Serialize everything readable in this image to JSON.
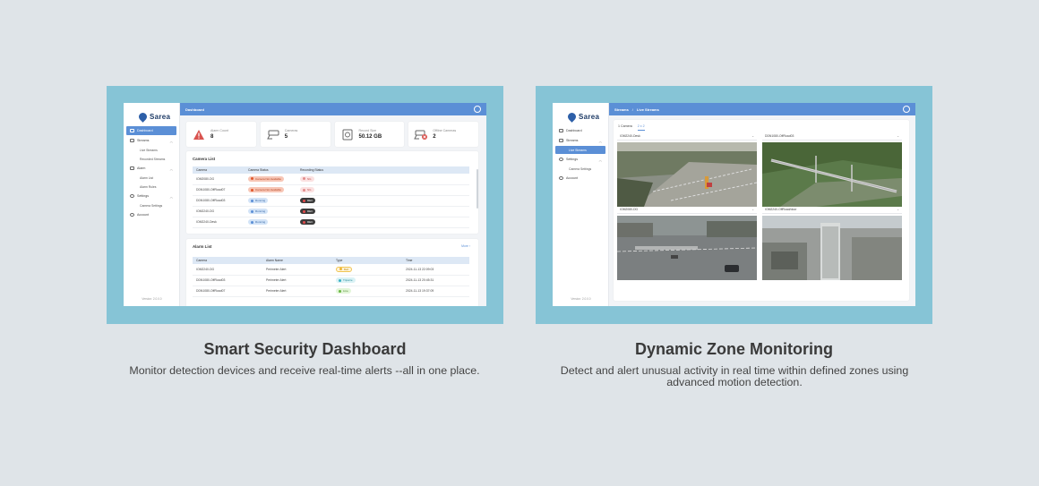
{
  "left_panel": {
    "logo_text": "Sarea",
    "sidebar": {
      "dashboard": "Dashboard",
      "streams": "Streams",
      "live_streams": "Live Streams",
      "recorded_streams": "Recorded Streams",
      "alarm": "Alarm",
      "alarm_list": "Alarm List",
      "alarm_rules": "Alarm Rules",
      "settings": "Settings",
      "camera_settings": "Camera Settings",
      "account": "Account",
      "version": "Version: 2.0.0.0"
    },
    "topbar_title": "Dashboard",
    "stats": [
      {
        "label": "Alarm Count",
        "value": "8",
        "icon": "warning-icon"
      },
      {
        "label": "Cameras",
        "value": "5",
        "icon": "camera-icon"
      },
      {
        "label": "Record Size",
        "value": "50.12 GB",
        "icon": "storage-icon"
      },
      {
        "label": "Offline Cameras",
        "value": "2",
        "icon": "camera-offline-icon"
      }
    ],
    "camera_list": {
      "title": "Camera List",
      "headers": [
        "Camera",
        "Camera Status",
        "Recording Status"
      ],
      "rows": [
        {
          "camera": "IOM2080-DG",
          "status": "Camera Not Available",
          "recording": "NG"
        },
        {
          "camera": "DDN1080-OffRoad07",
          "status": "Camera Not Available",
          "recording": "NG"
        },
        {
          "camera": "DDN1080-OffRoad03",
          "status": "Running",
          "recording": "REC"
        },
        {
          "camera": "IOM2240-DG",
          "status": "Running",
          "recording": "REC"
        },
        {
          "camera": "IOM2240-Desk",
          "status": "Running",
          "recording": "REC"
        }
      ]
    },
    "alarm_list": {
      "title": "Alarm List",
      "more": "More",
      "headers": [
        "Camera",
        "Alarm Name",
        "Type",
        "Time"
      ],
      "rows": [
        {
          "camera": "IOM2240-DG",
          "name": "Perimeter Alert",
          "type": "Bell",
          "time": "2024-11-13 22:09:03"
        },
        {
          "camera": "DDN1080-OffRoad03",
          "name": "Perimeter Alert",
          "type": "Tripwire",
          "time": "2024-11-13 20:45:31"
        },
        {
          "camera": "DDN1080-OffRoad07",
          "name": "Perimeter Alert",
          "type": "Line",
          "time": "2024-11-13 19:37:09"
        }
      ]
    }
  },
  "right_panel": {
    "logo_text": "Sarea",
    "sidebar": {
      "dashboard": "Dashboard",
      "streams": "Streams",
      "live_streams": "Live Streams",
      "settings": "Settings",
      "camera_settings": "Camera Settings",
      "account": "Account",
      "version": "Version: 2.0.0.0"
    },
    "breadcrumb": {
      "root": "Streams",
      "separator": "/",
      "current": "Live Streams"
    },
    "tabs": [
      "1 Camera",
      "2 x 2"
    ],
    "cameras": [
      {
        "name": "IOM2240-Desk"
      },
      {
        "name": "DDN1080-OffRoad03"
      },
      {
        "name": "IOM2080-DG"
      },
      {
        "name": "IOM2240-OffRoad/door"
      }
    ]
  },
  "captions": {
    "left_title": "Smart Security Dashboard",
    "left_desc": "Monitor detection devices and receive real-time alerts --all in one place.",
    "right_title": "Dynamic Zone Monitoring",
    "right_desc_1": "Detect and alert unusual activity in real time within defined zones using",
    "right_desc_2": "advanced motion detection."
  },
  "colors": {
    "background": "#dfe4e8",
    "panel": "#86c4d6",
    "accent": "#5b8fd6"
  }
}
